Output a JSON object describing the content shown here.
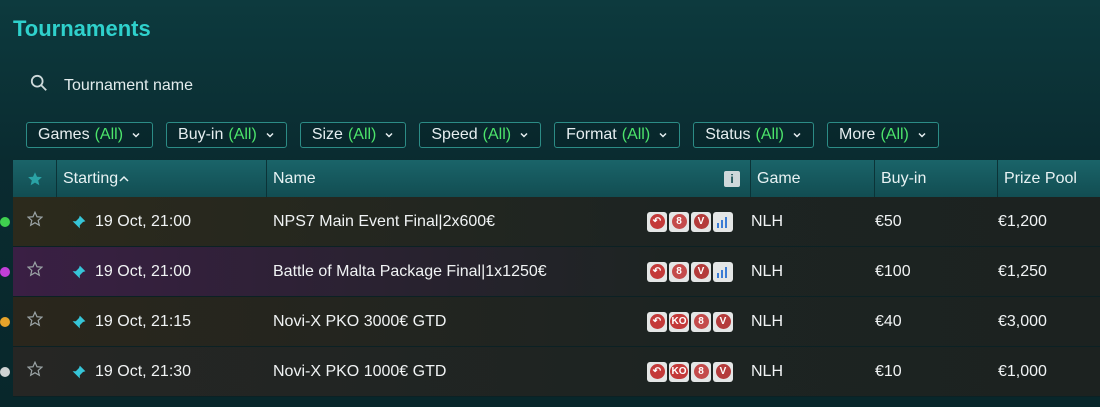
{
  "page": {
    "title": "Tournaments"
  },
  "search": {
    "placeholder": "Tournament name"
  },
  "filters": [
    {
      "label": "Games",
      "value": "(All)"
    },
    {
      "label": "Buy-in",
      "value": "(All)"
    },
    {
      "label": "Size",
      "value": "(All)"
    },
    {
      "label": "Speed",
      "value": "(All)"
    },
    {
      "label": "Format",
      "value": "(All)"
    },
    {
      "label": "Status",
      "value": "(All)"
    },
    {
      "label": "More",
      "value": "(All)"
    }
  ],
  "table": {
    "headers": {
      "starting": "Starting",
      "name": "Name",
      "game": "Game",
      "buyin": "Buy-in",
      "prize": "Prize Pool"
    },
    "rows": [
      {
        "dot_color": "#3fd04f",
        "starting": "19 Oct, 21:00",
        "name": "NPS7 Main Event Final|2x600€",
        "badges": [
          "re-entry-icon",
          "8",
          "V",
          "chart"
        ],
        "game": "NLH",
        "buyin": "€50",
        "prize": "€1,200",
        "bg": "#2c2a1c"
      },
      {
        "dot_color": "#c23fd8",
        "starting": "19 Oct, 21:00",
        "name": "Battle of Malta Package Final|1x1250€",
        "badges": [
          "re-entry-icon",
          "8",
          "V",
          "chart"
        ],
        "game": "NLH",
        "buyin": "€100",
        "prize": "€1,250",
        "bg": "#3a1f44"
      },
      {
        "dot_color": "#e7a32a",
        "starting": "19 Oct, 21:15",
        "name": "Novi-X PKO 3000€ GTD",
        "badges": [
          "re-entry-icon",
          "KO",
          "8",
          "V"
        ],
        "game": "NLH",
        "buyin": "€40",
        "prize": "€3,000",
        "bg": "#2a261c"
      },
      {
        "dot_color": "#cfd3d3",
        "starting": "19 Oct, 21:30",
        "name": "Novi-X PKO 1000€ GTD",
        "badges": [
          "re-entry-icon",
          "KO",
          "8",
          "V"
        ],
        "game": "NLH",
        "buyin": "€10",
        "prize": "€1,000",
        "bg": "#262624"
      }
    ]
  },
  "colors": {
    "accent": "#2fd1cc",
    "filter_all": "#4ce46b",
    "pin": "#36c5d8"
  }
}
